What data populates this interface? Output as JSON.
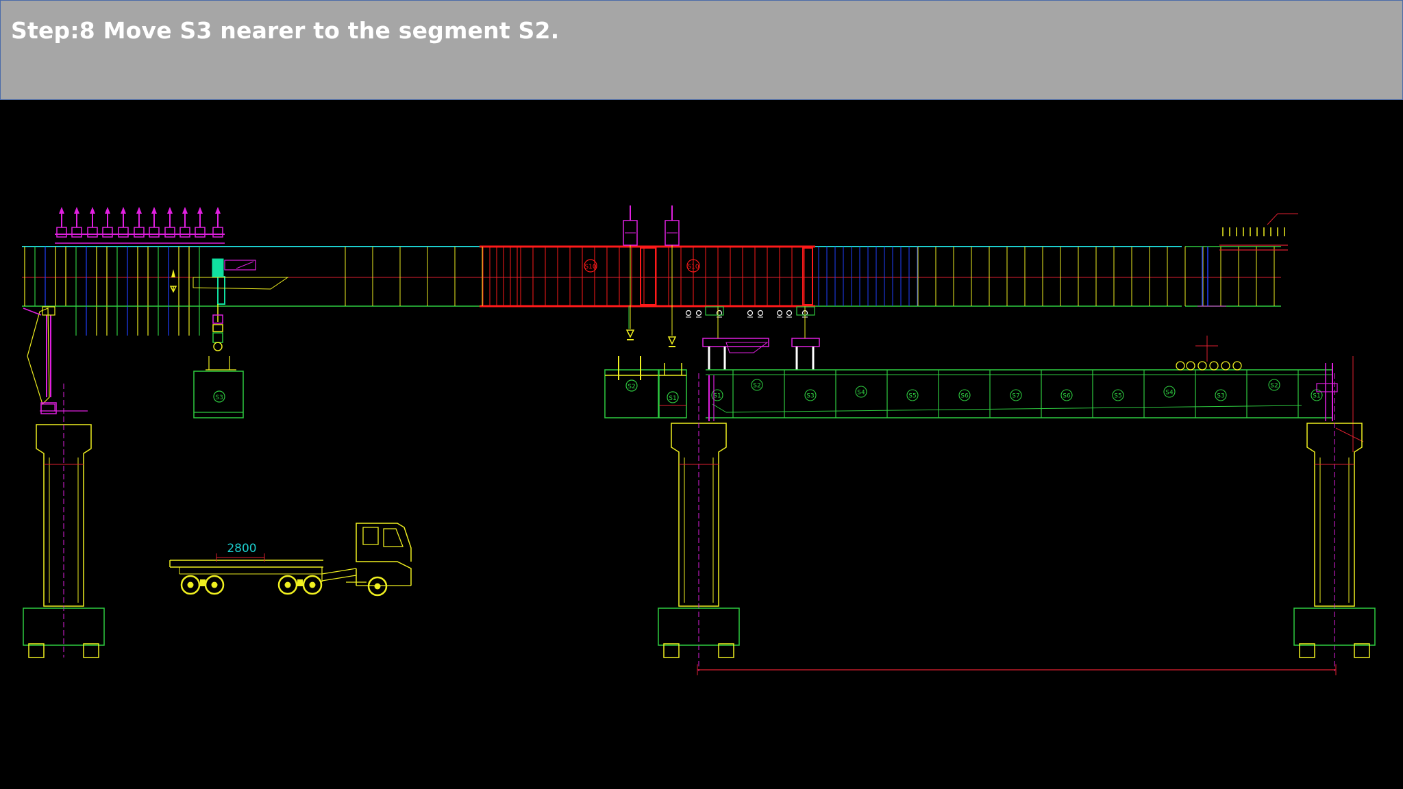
{
  "slide": {
    "title": "Step:8 Move S3 nearer to the segment S2."
  },
  "drawing": {
    "palette": {
      "green": "#2ecc40",
      "yellow": "#f0f020",
      "red": "#ff1a1a",
      "magenta": "#e020e0",
      "cyan": "#1ccfcf",
      "blue": "#2040ff",
      "white": "#ffffff",
      "teal": "#10e0a0"
    },
    "truck_dimension": "2800",
    "hanging_segment_label": "S3",
    "girder_tags": [
      "S10",
      "S10"
    ],
    "gantry_segment_labels": [
      "S2",
      "S1"
    ],
    "span_segment_labels": [
      "S1",
      "S2",
      "S3",
      "S4",
      "S5",
      "S6",
      "S7",
      "S6",
      "S5",
      "S4",
      "S3",
      "S2",
      "S1"
    ]
  }
}
